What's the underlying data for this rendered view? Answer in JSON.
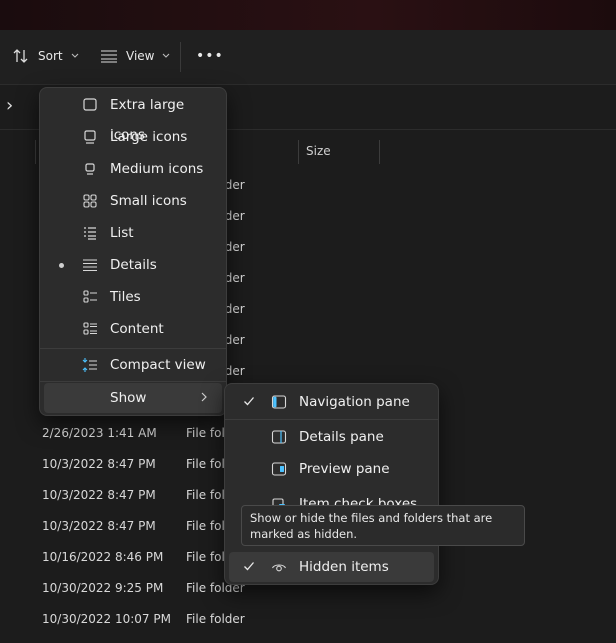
{
  "toolbar": {
    "sort_label": "Sort",
    "view_label": "View",
    "more_label": "•••"
  },
  "address": {
    "chevron": "›"
  },
  "columns": {
    "size": "Size"
  },
  "file_rows": {
    "dates": [
      "2/26/2023 1:41 AM",
      "10/3/2022 8:47 PM",
      "10/3/2022 8:47 PM",
      "10/3/2022 8:47 PM",
      "10/16/2022 8:46 PM",
      "10/30/2022 9:25 PM",
      "10/30/2022 10:07 PM"
    ],
    "types_partial": [
      "folder",
      "folder",
      "folder",
      "folder",
      "folder",
      "folder",
      "folder"
    ],
    "types": [
      "File folder",
      "File folder",
      "File folder",
      "File folder",
      "File folder",
      "File folder",
      "File folder"
    ]
  },
  "view_menu": {
    "items": [
      {
        "label": "Extra large icons",
        "icon": "extra-large-icons-icon"
      },
      {
        "label": "Large icons",
        "icon": "large-icons-icon"
      },
      {
        "label": "Medium icons",
        "icon": "medium-icons-icon"
      },
      {
        "label": "Small icons",
        "icon": "small-icons-icon"
      },
      {
        "label": "List",
        "icon": "list-icon"
      },
      {
        "label": "Details",
        "icon": "details-icon",
        "selected": true
      },
      {
        "label": "Tiles",
        "icon": "tiles-icon"
      },
      {
        "label": "Content",
        "icon": "content-icon"
      }
    ],
    "compact_label": "Compact view",
    "show_label": "Show"
  },
  "show_menu": {
    "items": [
      {
        "label": "Navigation pane",
        "checked": true,
        "icon": "navigation-pane-icon"
      },
      {
        "label": "Details pane",
        "checked": false,
        "icon": "details-pane-icon"
      },
      {
        "label": "Preview pane",
        "checked": false,
        "icon": "preview-pane-icon"
      },
      {
        "label": "Item check boxes",
        "checked": false,
        "icon": "item-check-boxes-icon"
      },
      {
        "label": "Hidden items",
        "checked": true,
        "icon": "hidden-items-icon"
      }
    ]
  },
  "tooltip": {
    "text": "Show or hide the files and folders that are marked as hidden."
  },
  "colors": {
    "accent": "#4cc2ff",
    "menu_bg": "#2c2c2c",
    "window_bg": "#1c1c1c"
  }
}
